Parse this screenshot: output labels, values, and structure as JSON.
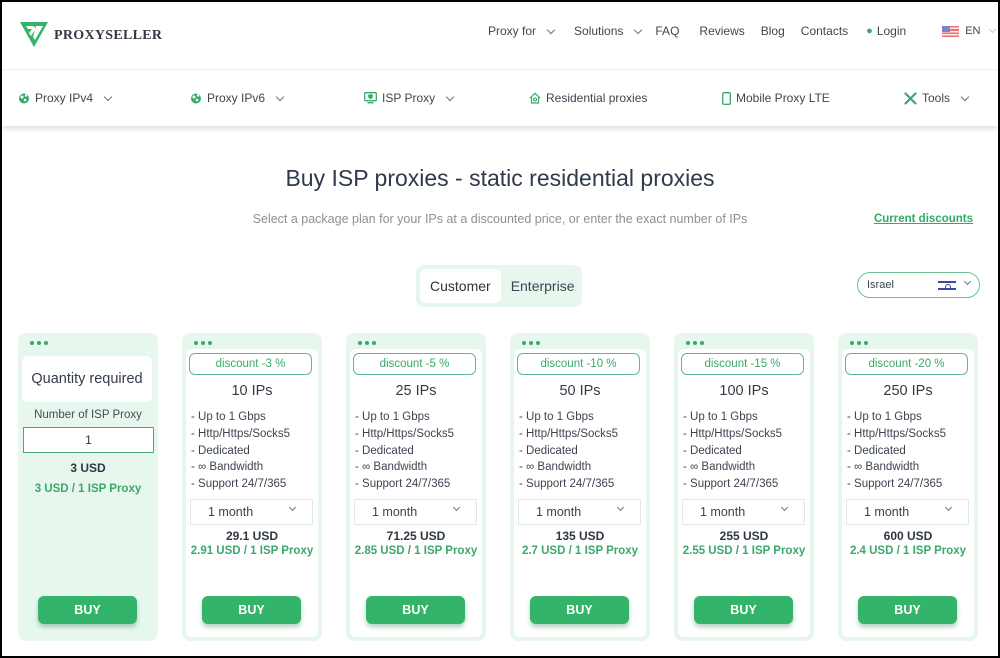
{
  "brand": {
    "name": "PROXYSELLER",
    "color": "#34b36a"
  },
  "topnav": {
    "items": [
      {
        "label": "Proxy for",
        "dropdown": true
      },
      {
        "label": "Solutions",
        "dropdown": true
      },
      {
        "label": "FAQ",
        "dropdown": false
      },
      {
        "label": "Reviews",
        "dropdown": false
      },
      {
        "label": "Blog",
        "dropdown": false
      },
      {
        "label": "Contacts",
        "dropdown": false
      }
    ],
    "login": {
      "label": "Login",
      "icon": "user-icon"
    },
    "language": {
      "label": "EN",
      "flag": "us-flag-icon"
    }
  },
  "subnav": {
    "items": [
      {
        "label": "Proxy IPv4",
        "icon": "globe-network-icon",
        "dropdown": true
      },
      {
        "label": "Proxy IPv6",
        "icon": "globe-network-icon",
        "dropdown": true
      },
      {
        "label": "ISP Proxy",
        "icon": "monitor-shield-icon",
        "dropdown": true
      },
      {
        "label": "Residential proxies",
        "icon": "home-icon",
        "dropdown": false
      },
      {
        "label": "Mobile Proxy LTE",
        "icon": "smartphone-icon",
        "dropdown": false
      },
      {
        "label": "Tools",
        "icon": "tools-icon",
        "dropdown": true
      }
    ]
  },
  "main": {
    "title": "Buy ISP proxies - static residential proxies",
    "subtitle": "Select a package plan for your IPs at a discounted price, or enter the exact number of IPs",
    "discounts_link": "Current discounts",
    "toggle": {
      "options": [
        "Customer",
        "Enterprise"
      ],
      "selected": "Customer"
    },
    "country": {
      "value": "Israel",
      "flag": "israel-flag-icon"
    }
  },
  "quantity_card": {
    "title": "Quantity required",
    "input_label": "Number of ISP Proxy",
    "input_value": "1",
    "price": "3 USD",
    "per_unit": "3 USD / 1 ISP Proxy",
    "buy_label": "BUY"
  },
  "plans": [
    {
      "discount": "discount -3 %",
      "ips": "10 IPs",
      "period": "1 month",
      "price": "29.1 USD",
      "per_unit": "2.91 USD / 1 ISP Proxy"
    },
    {
      "discount": "discount -5 %",
      "ips": "25 IPs",
      "period": "1 month",
      "price": "71.25 USD",
      "per_unit": "2.85 USD / 1 ISP Proxy"
    },
    {
      "discount": "discount -10 %",
      "ips": "50 IPs",
      "period": "1 month",
      "price": "135 USD",
      "per_unit": "2.7 USD / 1 ISP Proxy"
    },
    {
      "discount": "discount -15 %",
      "ips": "100 IPs",
      "period": "1 month",
      "price": "255 USD",
      "per_unit": "2.55 USD / 1 ISP Proxy"
    },
    {
      "discount": "discount -20 %",
      "ips": "250 IPs",
      "period": "1 month",
      "price": "600 USD",
      "per_unit": "2.4 USD / 1 ISP Proxy"
    }
  ],
  "plan_features": [
    "- Up to 1 Gbps",
    "- Http/Https/Socks5",
    "- Dedicated",
    "- ∞ Bandwidth",
    "- Support 24/7/365"
  ],
  "buy_label": "BUY"
}
